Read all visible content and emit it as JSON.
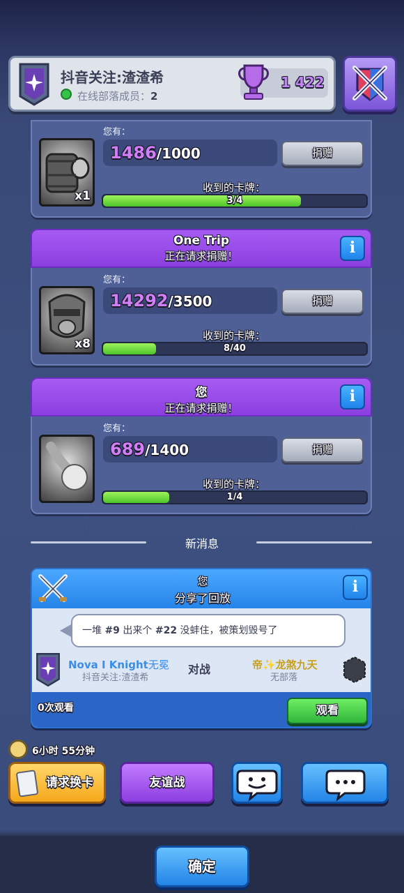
{
  "header": {
    "clan_name": "抖音关注:渣渣希",
    "online_label": "在线部落成员：",
    "online_count": "2",
    "trophies": "1 422"
  },
  "requests": [
    {
      "requester": "",
      "subtitle": "",
      "have_label": "您有：",
      "have_count": "1486",
      "have_needed": "/1000",
      "donate_label": "捐赠",
      "received_label": "收到的卡牌：",
      "progress_text": "3/4",
      "progress": 0.75,
      "card_qty": "x1",
      "card_icon": "cannon-card-icon"
    },
    {
      "requester": "One Trip",
      "subtitle": "正在请求捐赠！",
      "info": "i",
      "have_label": "您有：",
      "have_count": "14292",
      "have_needed": "/3500",
      "donate_label": "捐赠",
      "received_label": "收到的卡牌：",
      "progress_text": "8/40",
      "progress": 0.2,
      "card_qty": "x8",
      "card_icon": "knight-card-icon"
    },
    {
      "requester": "您",
      "subtitle": "正在请求捐赠！",
      "info": "i",
      "have_label": "您有：",
      "have_count": "689",
      "have_needed": "/1400",
      "donate_label": "捐赠",
      "received_label": "收到的卡牌：",
      "progress_text": "1/4",
      "progress": 0.25,
      "card_icon": "fireball-card-icon"
    }
  ],
  "news": {
    "title": "新消息"
  },
  "replay": {
    "sender": "您",
    "action": "分享了回放",
    "info": "i",
    "message_part1": "一堆",
    "message_num1": "#9",
    "message_part2": "出来个",
    "message_num2": "#22",
    "message_part3": "没蚌住，被策划毁号了",
    "player1_name": "Nova I Knight",
    "player1_suffix": "无冕",
    "player1_clan": "抖音关注:渣渣希",
    "vs_label": "对战",
    "player2_name": "帝✨龙煞九天",
    "player2_clan": "无部落",
    "views": "0次观看",
    "watch_label": "观看"
  },
  "bottom": {
    "timer": "6小时 55分钟",
    "request_label": "请求换卡",
    "friendly_label": "友谊战",
    "confirm_label": "确定"
  },
  "colors": {
    "purple_header": "#9a4ae8",
    "blue_header": "#2f8ff0",
    "progress_green": "#5fd435",
    "have_purple": "#d27ef7"
  }
}
